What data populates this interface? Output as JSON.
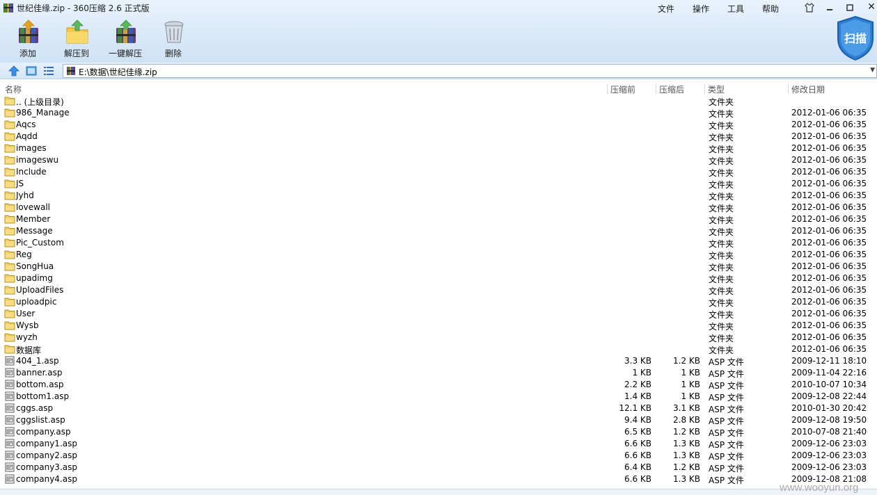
{
  "window": {
    "title": "世纪佳缘.zip - 360压缩 2.6 正式版",
    "menus": [
      "文件",
      "操作",
      "工具",
      "帮助"
    ]
  },
  "toolbar": {
    "add_label": "添加",
    "extract_to_label": "解压到",
    "one_click_extract_label": "一键解压",
    "delete_label": "删除",
    "scan_label": "扫描"
  },
  "address": {
    "path": "E:\\数据\\世纪佳缘.zip"
  },
  "columns": {
    "name": "名称",
    "original_size": "压缩前",
    "compressed_size": "压缩后",
    "type": "类型",
    "modified": "修改日期"
  },
  "rows": [
    {
      "kind": "folder",
      "name": ".. (上级目录)",
      "size": "",
      "packed": "",
      "type": "文件夹",
      "date": ""
    },
    {
      "kind": "folder",
      "name": "986_Manage",
      "size": "",
      "packed": "",
      "type": "文件夹",
      "date": "2012-01-06 06:35"
    },
    {
      "kind": "folder",
      "name": "Aqcs",
      "size": "",
      "packed": "",
      "type": "文件夹",
      "date": "2012-01-06 06:35"
    },
    {
      "kind": "folder",
      "name": "Aqdd",
      "size": "",
      "packed": "",
      "type": "文件夹",
      "date": "2012-01-06 06:35"
    },
    {
      "kind": "folder",
      "name": "images",
      "size": "",
      "packed": "",
      "type": "文件夹",
      "date": "2012-01-06 06:35"
    },
    {
      "kind": "folder",
      "name": "imageswu",
      "size": "",
      "packed": "",
      "type": "文件夹",
      "date": "2012-01-06 06:35"
    },
    {
      "kind": "folder",
      "name": "Include",
      "size": "",
      "packed": "",
      "type": "文件夹",
      "date": "2012-01-06 06:35"
    },
    {
      "kind": "folder",
      "name": "JS",
      "size": "",
      "packed": "",
      "type": "文件夹",
      "date": "2012-01-06 06:35"
    },
    {
      "kind": "folder",
      "name": "Jyhd",
      "size": "",
      "packed": "",
      "type": "文件夹",
      "date": "2012-01-06 06:35"
    },
    {
      "kind": "folder",
      "name": "lovewall",
      "size": "",
      "packed": "",
      "type": "文件夹",
      "date": "2012-01-06 06:35"
    },
    {
      "kind": "folder",
      "name": "Member",
      "size": "",
      "packed": "",
      "type": "文件夹",
      "date": "2012-01-06 06:35"
    },
    {
      "kind": "folder",
      "name": "Message",
      "size": "",
      "packed": "",
      "type": "文件夹",
      "date": "2012-01-06 06:35"
    },
    {
      "kind": "folder",
      "name": "Pic_Custom",
      "size": "",
      "packed": "",
      "type": "文件夹",
      "date": "2012-01-06 06:35"
    },
    {
      "kind": "folder",
      "name": "Reg",
      "size": "",
      "packed": "",
      "type": "文件夹",
      "date": "2012-01-06 06:35"
    },
    {
      "kind": "folder",
      "name": "SongHua",
      "size": "",
      "packed": "",
      "type": "文件夹",
      "date": "2012-01-06 06:35"
    },
    {
      "kind": "folder",
      "name": "upadimg",
      "size": "",
      "packed": "",
      "type": "文件夹",
      "date": "2012-01-06 06:35"
    },
    {
      "kind": "folder",
      "name": "UploadFiles",
      "size": "",
      "packed": "",
      "type": "文件夹",
      "date": "2012-01-06 06:35"
    },
    {
      "kind": "folder",
      "name": "uploadpic",
      "size": "",
      "packed": "",
      "type": "文件夹",
      "date": "2012-01-06 06:35"
    },
    {
      "kind": "folder",
      "name": "User",
      "size": "",
      "packed": "",
      "type": "文件夹",
      "date": "2012-01-06 06:35"
    },
    {
      "kind": "folder",
      "name": "Wysb",
      "size": "",
      "packed": "",
      "type": "文件夹",
      "date": "2012-01-06 06:35"
    },
    {
      "kind": "folder",
      "name": "wyzh",
      "size": "",
      "packed": "",
      "type": "文件夹",
      "date": "2012-01-06 06:35"
    },
    {
      "kind": "folder",
      "name": "数据库",
      "size": "",
      "packed": "",
      "type": "文件夹",
      "date": "2012-01-06 06:35"
    },
    {
      "kind": "file",
      "name": "404_1.asp",
      "size": "3.3 KB",
      "packed": "1.2 KB",
      "type": "ASP 文件",
      "date": "2009-12-11 18:10"
    },
    {
      "kind": "file",
      "name": "banner.asp",
      "size": "1 KB",
      "packed": "1 KB",
      "type": "ASP 文件",
      "date": "2009-11-04 22:16"
    },
    {
      "kind": "file",
      "name": "bottom.asp",
      "size": "2.2 KB",
      "packed": "1 KB",
      "type": "ASP 文件",
      "date": "2010-10-07 10:34"
    },
    {
      "kind": "file",
      "name": "bottom1.asp",
      "size": "1.4 KB",
      "packed": "1 KB",
      "type": "ASP 文件",
      "date": "2009-12-08 22:44"
    },
    {
      "kind": "file",
      "name": "cggs.asp",
      "size": "12.1 KB",
      "packed": "3.1 KB",
      "type": "ASP 文件",
      "date": "2010-01-30 20:42"
    },
    {
      "kind": "file",
      "name": "cggslist.asp",
      "size": "9.4 KB",
      "packed": "2.8 KB",
      "type": "ASP 文件",
      "date": "2009-12-08 19:50"
    },
    {
      "kind": "file",
      "name": "company.asp",
      "size": "6.5 KB",
      "packed": "1.2 KB",
      "type": "ASP 文件",
      "date": "2010-07-08 21:40"
    },
    {
      "kind": "file",
      "name": "company1.asp",
      "size": "6.6 KB",
      "packed": "1.3 KB",
      "type": "ASP 文件",
      "date": "2009-12-06 23:03"
    },
    {
      "kind": "file",
      "name": "company2.asp",
      "size": "6.6 KB",
      "packed": "1.3 KB",
      "type": "ASP 文件",
      "date": "2009-12-06 23:03"
    },
    {
      "kind": "file",
      "name": "company3.asp",
      "size": "6.4 KB",
      "packed": "1.2 KB",
      "type": "ASP 文件",
      "date": "2009-12-06 23:03"
    },
    {
      "kind": "file",
      "name": "company4.asp",
      "size": "6.6 KB",
      "packed": "1.3 KB",
      "type": "ASP 文件",
      "date": "2009-12-08 21:08"
    }
  ],
  "watermark": "www.wooyun.org",
  "colors": {
    "folder": "#e9c55a",
    "accent_blue": "#2f7fd6",
    "header_bg": "#d9e9f8"
  }
}
